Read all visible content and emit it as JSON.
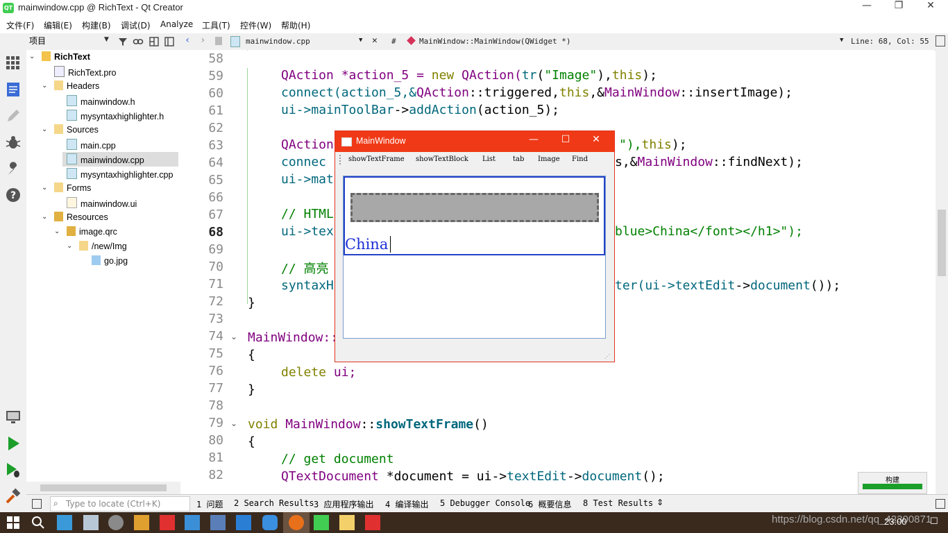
{
  "window": {
    "title": "mainwindow.cpp @ RichText - Qt Creator",
    "minimize": "—",
    "restore": "❐",
    "close": "✕"
  },
  "menu": [
    "文件(F)",
    "编辑(E)",
    "构建(B)",
    "调试(D)",
    "Analyze",
    "工具(T)",
    "控件(W)",
    "帮助(H)"
  ],
  "project_panel": {
    "selector": "项目"
  },
  "tree": {
    "root": "RichText",
    "pro": "RichText.pro",
    "headers": "Headers",
    "h1": "mainwindow.h",
    "h2": "mysyntaxhighlighter.h",
    "sources": "Sources",
    "s1": "main.cpp",
    "s2": "mainwindow.cpp",
    "s3": "mysyntaxhighlighter.cpp",
    "forms": "Forms",
    "f1": "mainwindow.ui",
    "resources": "Resources",
    "qrc": "image.qrc",
    "prefix": "/new/Img",
    "img": "go.jpg"
  },
  "editor": {
    "file": "mainwindow.cpp",
    "hash": "#",
    "symbol": "MainWindow::MainWindow(QWidget *)",
    "position": "Line: 68, Col: 55"
  },
  "line_numbers": [
    "58",
    "59",
    "60",
    "61",
    "62",
    "63",
    "64",
    "65",
    "66",
    "67",
    "68",
    "69",
    "70",
    "71",
    "72",
    "73",
    "74",
    "75",
    "76",
    "77",
    "78",
    "79",
    "80",
    "81",
    "82"
  ],
  "code": {
    "l59": [
      "QAction *action_5 = ",
      "new",
      " QAction(",
      "tr",
      "(",
      "\"Image\"",
      "),",
      "this",
      ");"
    ],
    "l60": [
      "connect(action_5,&",
      "QAction",
      "::triggered,",
      "this",
      ",&",
      "MainWindow",
      "::insertImage);"
    ],
    "l61": [
      "ui->",
      "mainToolBar",
      "->",
      "addAction",
      "(action_5);"
    ],
    "l63a": "QAction",
    "l63b": "\"),",
    "l63c": "this",
    "l63d": ");",
    "l64a": "connec",
    "l64b": "s,&",
    "l64c": "MainWindow",
    "l64d": "::findNext);",
    "l65": "ui->mat",
    "l67": "// HTML",
    "l68a": "ui->tex",
    "l68b": "blue>China</font></h1>\");",
    "l70": "// 高亮",
    "l71a": "syntaxH",
    "l71b": "ter(ui->",
    "l71c": "textEdit",
    "l71d": "->",
    "l71e": "document",
    "l71f": "());",
    "l72": "}",
    "l74": "MainWindow::",
    "l75": "{",
    "l76a": "delete",
    "l76b": " ui;",
    "l77": "}",
    "l79a": "void",
    "l79b": " MainWindow",
    "l79c": "::",
    "l79d": "showTextFrame",
    "l79e": "()",
    "l80": "{",
    "l81": "// get document",
    "l82a": "QTextDocument",
    "l82b": " *document = ui->",
    "l82c": "textEdit",
    "l82d": "->",
    "l82e": "document",
    "l82f": "();"
  },
  "locator": {
    "placeholder": "Type to locate (Ctrl+K)"
  },
  "output_tabs": [
    "1 问题",
    "2 Search Results",
    "3 应用程序输出",
    "4 编译输出",
    "5 Debugger Console",
    "6 概要信息",
    "8 Test Results"
  ],
  "build_progress": {
    "label": "构建",
    "progress": 1.0
  },
  "app_window": {
    "title": "MainWindow",
    "toolbar": [
      "showTextFrame",
      "showTextBlock",
      "List",
      "tab",
      "Image",
      "Find"
    ],
    "text": "China"
  },
  "taskbar": {
    "time": "23:00",
    "watermark": "https://blog.csdn.net/qq_42300871"
  },
  "colors": {
    "titlebar": "#f03a17",
    "keyword": "#808000",
    "type": "#800080",
    "string": "#008000",
    "taskbar": "#3a2a1e",
    "accent": "#1b9e2a"
  }
}
